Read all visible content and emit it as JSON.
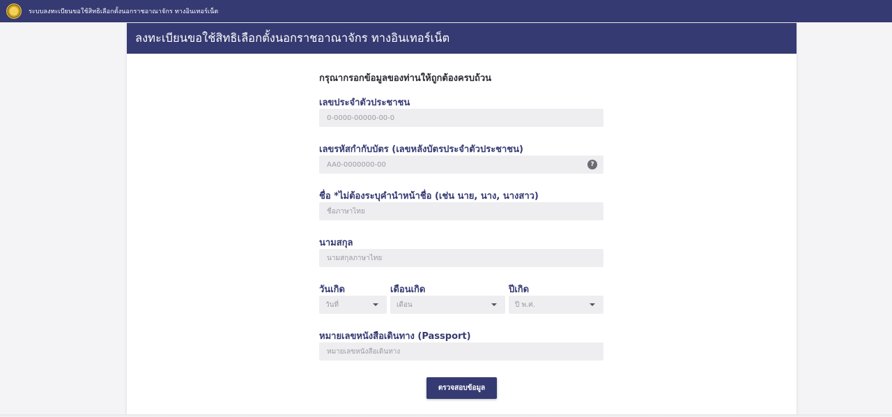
{
  "topbar": {
    "logo_icon": "government-seal-icon",
    "title": "ระบบลงทะเบียนขอใช้สิทธิเลือกตั้งนอกราชอาณาจักร ทางอินเทอร์เน็ต"
  },
  "card": {
    "title": "ลงทะเบียนขอใช้สิทธิเลือกตั้งนอกราชอาณาจักร ทางอินเทอร์เน็ต"
  },
  "form": {
    "instruction": "กรุณากรอกข้อมูลของท่านให้ถูกต้องครบถ้วน",
    "id_card": {
      "label": "เลขประจำตัวประชาชน",
      "placeholder": "0-0000-00000-00-0",
      "value": ""
    },
    "laser_code": {
      "label": "เลขรหัสกำกับบัตร (เลขหลังบัตรประจำตัวประชาชน)",
      "placeholder": "AA0-0000000-00",
      "value": "",
      "help": "?"
    },
    "first_name": {
      "label": "ชื่อ *ไม่ต้องระบุคำนำหน้าชื่อ (เช่น นาย, นาง, นางสาว)",
      "placeholder": "ชื่อภาษาไทย",
      "value": ""
    },
    "last_name": {
      "label": "นามสกุล",
      "placeholder": "นามสกุลภาษาไทย",
      "value": ""
    },
    "birth": {
      "day_label": "วันเกิด",
      "day_selected": "วันที่",
      "month_label": "เดือนเกิด",
      "month_selected": "เดือน",
      "year_label": "ปีเกิด",
      "year_selected": "ปี พ.ศ."
    },
    "passport": {
      "label": "หมายเลขหนังสือเดินทาง (Passport)",
      "placeholder": "หมายเลขหนังสือเดินทาง",
      "value": ""
    },
    "submit_label": "ตรวจสอบข้อมูล"
  },
  "colors": {
    "brand": "#353a72",
    "field_bg": "#eeeef1",
    "page_bg": "#f4f4f6"
  }
}
